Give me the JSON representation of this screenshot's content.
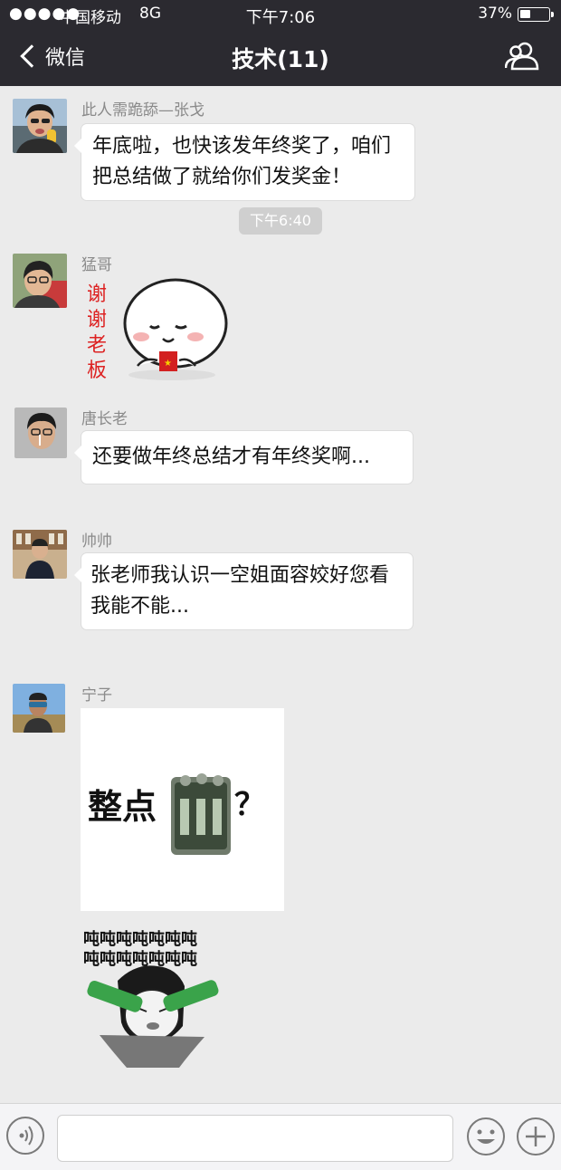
{
  "status_bar": {
    "signal": "●●●●●",
    "carrier": "中国移动",
    "network": "8G",
    "time": "下午7:06",
    "battery_text": "37%",
    "battery_level": 0.37
  },
  "nav": {
    "back_label": "微信",
    "title": "技术(11)",
    "contacts_icon": "group-contacts-icon"
  },
  "messages": [
    {
      "sender": "此人需跪舔—张戈",
      "type": "text",
      "lines": [
        "年底啦，也快该发年终奖了，咱们",
        "把总结做了就给你们发奖金！"
      ]
    },
    {
      "timestamp": "下午6:40"
    },
    {
      "sender": "猛哥",
      "type": "sticker",
      "sticker_text": [
        "谢",
        "谢",
        "老",
        "板"
      ]
    },
    {
      "sender": "唐长老",
      "type": "text",
      "lines": [
        "还要做年终总结才有年终奖啊..."
      ]
    },
    {
      "sender": "帅帅",
      "type": "text",
      "lines": [
        "张老师我认识一空姐面容姣好您看",
        "我能不能..."
      ]
    },
    {
      "sender": "宁子",
      "type": "image",
      "image_text_left": "整点",
      "image_text_right": "？"
    },
    {
      "type": "sticker2",
      "sticker_text": [
        "吨吨吨吨吨吨吨",
        "吨吨吨吨吨吨吨"
      ]
    }
  ],
  "input_bar": {
    "placeholder": "",
    "voice_icon": "voice-icon",
    "emoji_icon": "emoji-icon",
    "plus_icon": "plus-icon"
  },
  "colors": {
    "topbar": "#2b2a30",
    "chat_bg": "#ebebeb",
    "bubble": "#ffffff",
    "time_chip": "#cfcfcf"
  }
}
